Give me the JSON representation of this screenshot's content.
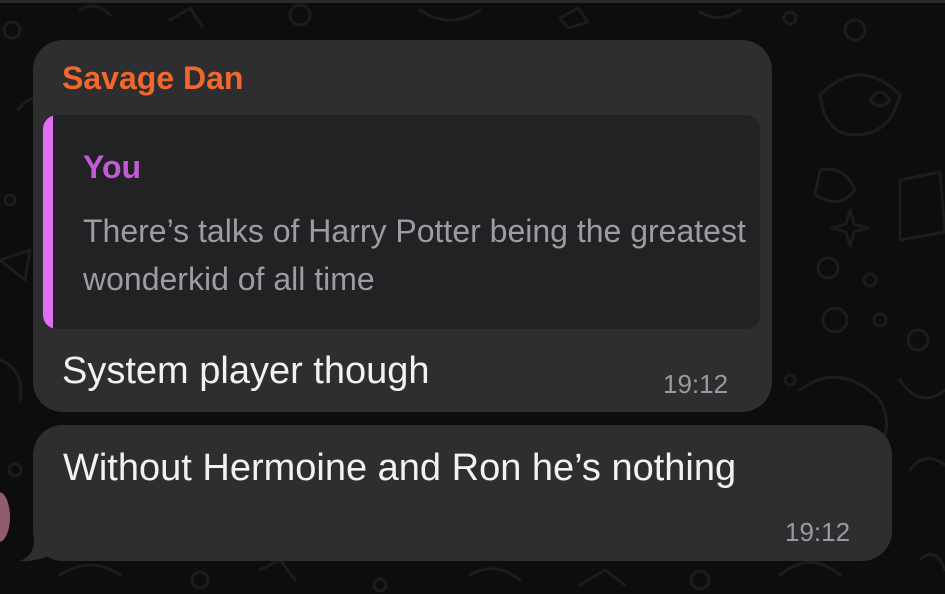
{
  "messages": [
    {
      "sender": "Savage Dan",
      "reply": {
        "author": "You",
        "text": "There’s talks of Harry Potter being the greatest wonderkid of all time"
      },
      "text": "System player though",
      "time": "19:12"
    },
    {
      "text": "Without Hermoine and Ron he’s nothing",
      "time": "19:12"
    }
  ],
  "colors": {
    "background": "#0d0d0e",
    "bubble": "#2e2e30",
    "quote_background": "#222224",
    "sender_name": "#f2682c",
    "reply_author": "#c25bd6",
    "reply_bar": "#e46ef3",
    "message_text": "#f2f2f2",
    "time_text": "#9a9a9e"
  }
}
